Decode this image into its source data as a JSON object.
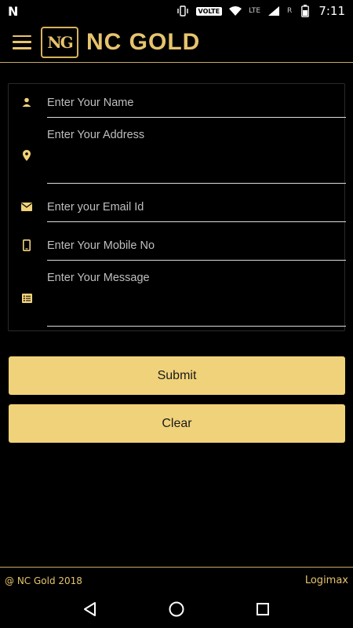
{
  "status_bar": {
    "carrier_logo": "N",
    "volte": "VOLTE",
    "lte": "LTE",
    "roaming": "R",
    "time": "7:11",
    "icons": [
      "vibrate-icon",
      "wifi-icon",
      "signal-icon",
      "battery-icon"
    ]
  },
  "header": {
    "logo_mark": "NG",
    "brand": "NC GOLD",
    "accent_color": "#e6c46e"
  },
  "form": {
    "fields": [
      {
        "placeholder": "Enter Your Name",
        "icon": "person-icon"
      },
      {
        "placeholder": "Enter Your Address",
        "icon": "location-pin-icon"
      },
      {
        "placeholder": "Enter your Email Id",
        "icon": "email-icon"
      },
      {
        "placeholder": "Enter Your Mobile No",
        "icon": "mobile-phone-icon"
      },
      {
        "placeholder": "Enter Your Message",
        "icon": "message-list-icon"
      }
    ],
    "submit_label": "Submit",
    "clear_label": "Clear",
    "button_color": "#f0d27a"
  },
  "footer": {
    "copyright": "@ NC Gold 2018",
    "credit": "Logimax"
  },
  "nav": {
    "icons": [
      "back-icon",
      "home-icon",
      "recents-icon"
    ]
  }
}
